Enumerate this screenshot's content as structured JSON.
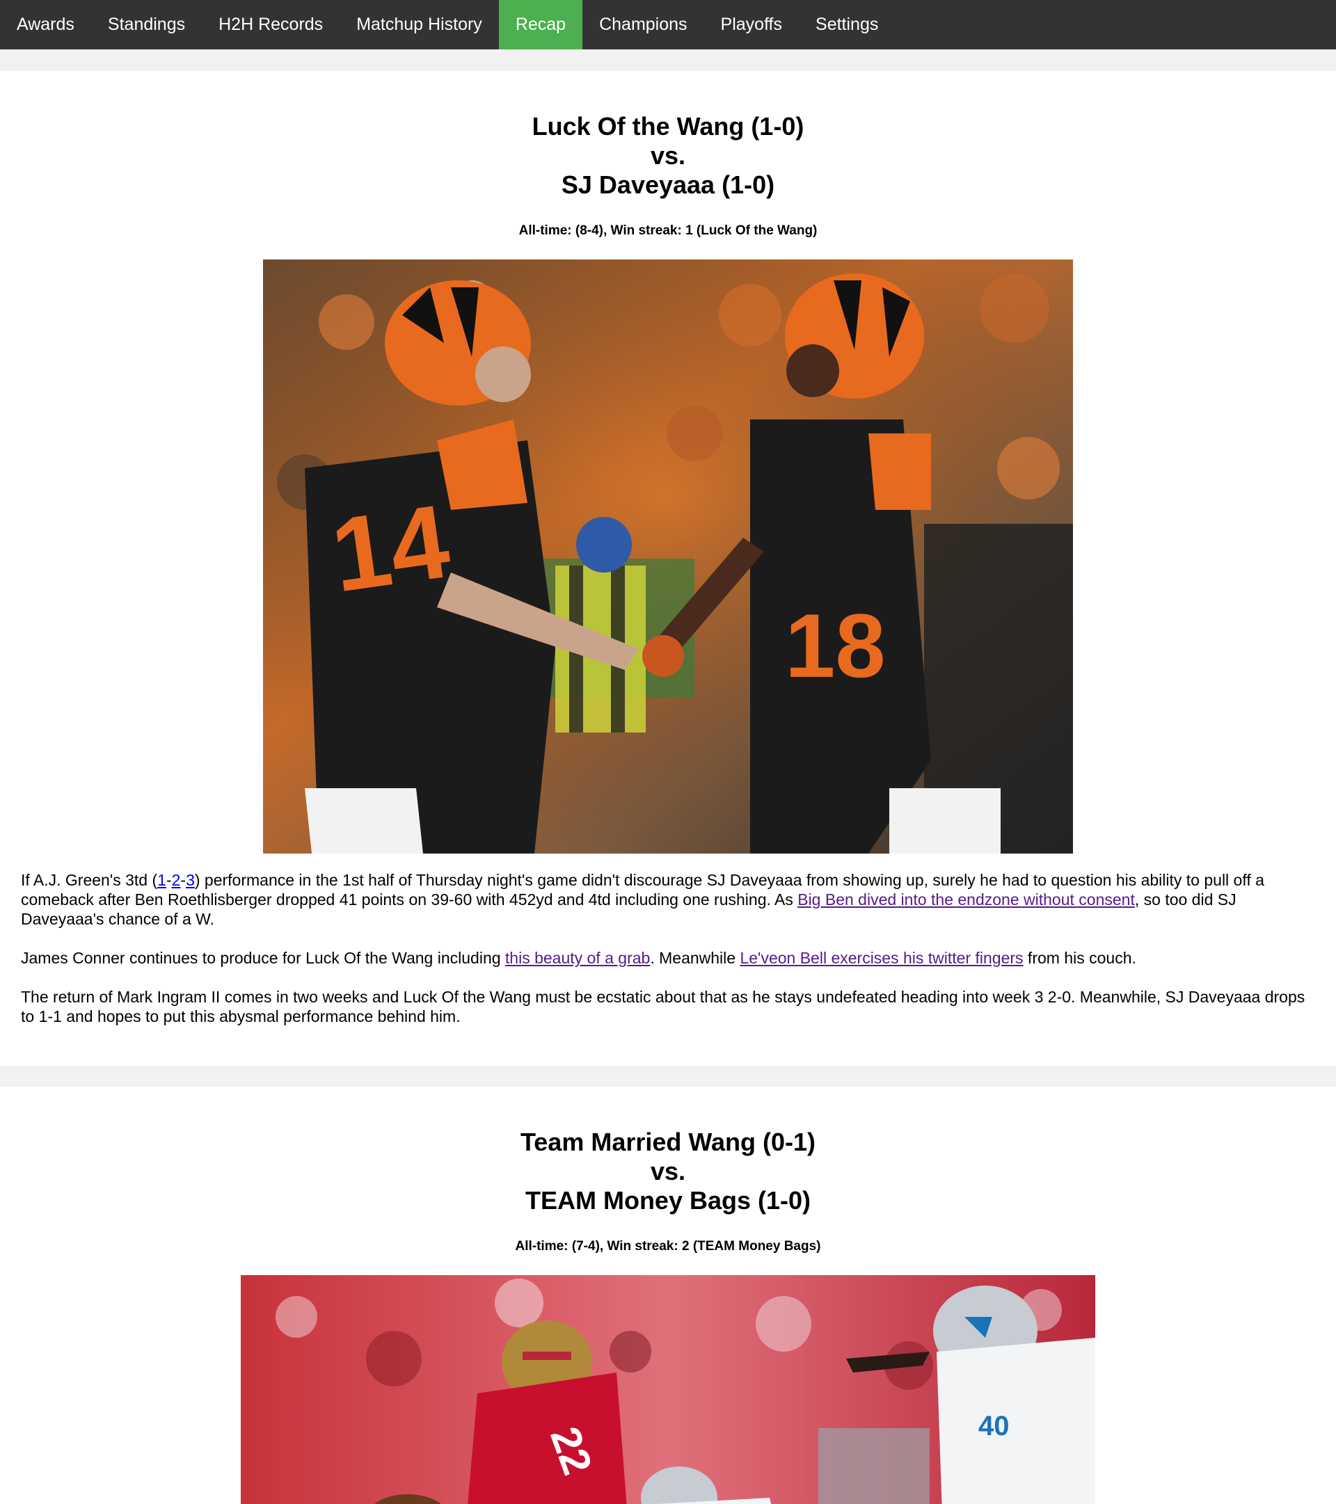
{
  "nav": {
    "items": [
      {
        "label": "Awards"
      },
      {
        "label": "Standings"
      },
      {
        "label": "H2H Records"
      },
      {
        "label": "Matchup History"
      },
      {
        "label": "Recap",
        "active": true
      },
      {
        "label": "Champions"
      },
      {
        "label": "Playoffs"
      },
      {
        "label": "Settings"
      }
    ],
    "colors": {
      "bar": "#333333",
      "active": "#4caf50",
      "text": "#ffffff"
    }
  },
  "matchups": [
    {
      "team1": "Luck Of the Wang (1-0)",
      "vs": "vs.",
      "team2": "SJ Daveyaaa (1-0)",
      "alltime": "All-time: (8-4), Win streak: 1 (Luck Of the Wang)",
      "photo_icon": "football-players-handshake-photo",
      "p1": {
        "t1": "If A.J. Green's 3td (",
        "link1": "1",
        "d1": "-",
        "link2": "2",
        "d2": "-",
        "link3": "3",
        "t2": ") performance in the 1st half of Thursday night's game didn't discourage SJ Daveyaaa from showing up, surely he had to question his ability to pull off a comeback after Ben Roethlisberger dropped 41 points on 39-60 with 452yd and 4td including one rushing. As ",
        "link4": "Big Ben dived into the endzone without consent",
        "t3": ", so too did SJ Daveyaaa's chance of a W."
      },
      "p2": {
        "t1": "James Conner continues to produce for Luck Of the Wang including ",
        "link1": "this beauty of a grab",
        "t2": ". Meanwhile ",
        "link2": "Le'veon Bell exercises his twitter fingers",
        "t3": " from his couch."
      },
      "p3": {
        "t1": "The return of Mark Ingram II comes in two weeks and Luck Of the Wang must be ecstatic about that as he stays undefeated heading into week 3 2-0. Meanwhile, SJ Daveyaaa drops to 1-1 and hopes to put this abysmal performance behind him."
      }
    },
    {
      "team1": "Team Married Wang (0-1)",
      "vs": "vs.",
      "team2": "TEAM Money Bags (1-0)",
      "alltime": "All-time: (7-4), Win streak: 2 (TEAM Money Bags)",
      "photo_icon": "football-game-action-photo"
    }
  ]
}
